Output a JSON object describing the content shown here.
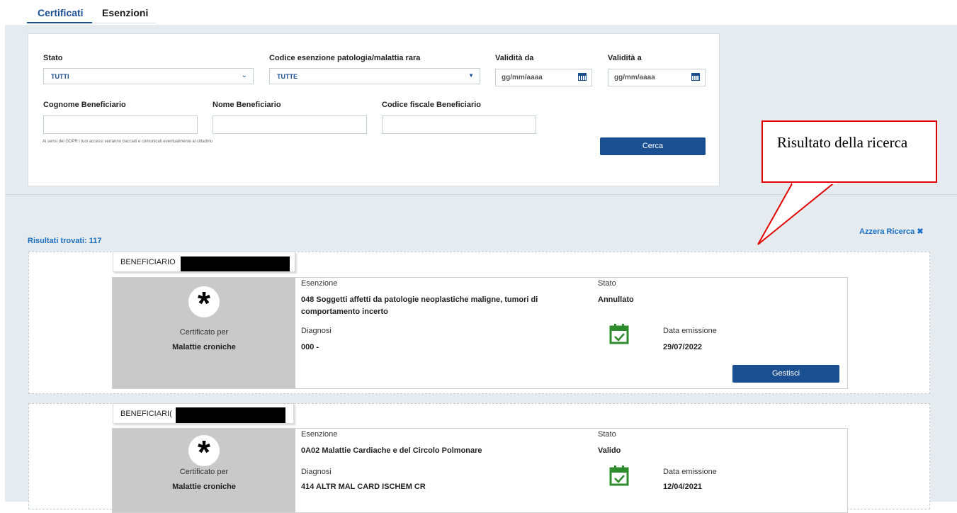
{
  "tabs": [
    {
      "label": "Certificati",
      "active": true
    },
    {
      "label": "Esenzioni",
      "active": false
    }
  ],
  "filters": {
    "stato": {
      "label": "Stato",
      "value": "TUTTI"
    },
    "codice": {
      "label": "Codice esenzione patologia/malattia rara",
      "value": "TUTTE"
    },
    "validita_da": {
      "label": "Validità da",
      "placeholder": "gg/mm/aaaa"
    },
    "validita_a": {
      "label": "Validità a",
      "placeholder": "gg/mm/aaaa"
    },
    "cognome": {
      "label": "Cognome Beneficiario",
      "value": ""
    },
    "nome": {
      "label": "Nome Beneficiario",
      "value": ""
    },
    "codice_fiscale": {
      "label": "Codice fiscale Beneficiario",
      "value": ""
    },
    "gdpr_note": "Ai sensi del GDPR i tuoi accessi verranno tracciati e comunicati eventualmente al cittadino",
    "search_button": "Cerca"
  },
  "callout": {
    "text": "Risultato della ricerca"
  },
  "results": {
    "count_label": "Risultati trovati: 117",
    "reset_label": "Azzera Ricerca ✖",
    "items": [
      {
        "beneficiario_label": "BENEFICIARIO",
        "certificato_per": "Certificato per",
        "tipo": "Malattie croniche",
        "esenzione_label": "Esenzione",
        "esenzione_line1": "048 Soggetti affetti da patologie neoplastiche maligne, tumori di",
        "esenzione_line2": "comportamento incerto",
        "stato_label": "Stato",
        "stato": "Annullato",
        "diagnosi_label": "Diagnosi",
        "diagnosi": "000 -",
        "data_label": "Data emissione",
        "data": "29/07/2022",
        "button": "Gestisci"
      },
      {
        "beneficiario_label": "BENEFICIARI(",
        "certificato_per": "Certificato per",
        "tipo": "Malattie croniche",
        "esenzione_label": "Esenzione",
        "esenzione_line1": "0A02 Malattie Cardiache e del Circolo Polmonare",
        "stato_label": "Stato",
        "stato": "Valido",
        "diagnosi_label": "Diagnosi",
        "diagnosi": "414 ALTR MAL CARD ISCHEM CR",
        "data_label": "Data emissione",
        "data": "12/04/2021"
      }
    ]
  },
  "colors": {
    "primary": "#1a4f91",
    "link": "#1a6fc0",
    "callout_border": "#e00000",
    "calendar_icon": "#2e8b2e"
  },
  "icons": {
    "date_picker": "calendar-icon",
    "card_icon": "asterisk-icon",
    "emission": "calendar-check-icon"
  }
}
